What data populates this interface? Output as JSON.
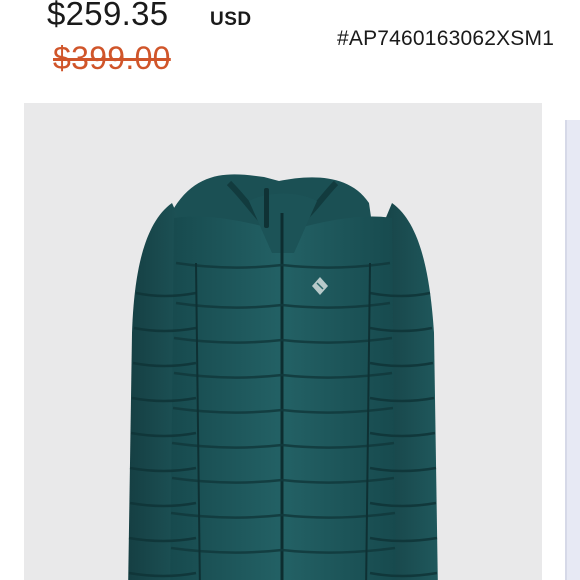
{
  "product": {
    "current_price": "$259.35",
    "currency": "USD",
    "original_price": "$399.00",
    "sku": "#AP7460163062XSM1"
  },
  "colors": {
    "current_price": "#1a1a1a",
    "original_price": "#d0552a",
    "jacket": "#1f5a5e",
    "image_background": "#e9e9ea"
  },
  "image": {
    "subject": "teal hooded down jacket",
    "logo_icon": "diamond-logo-icon"
  }
}
